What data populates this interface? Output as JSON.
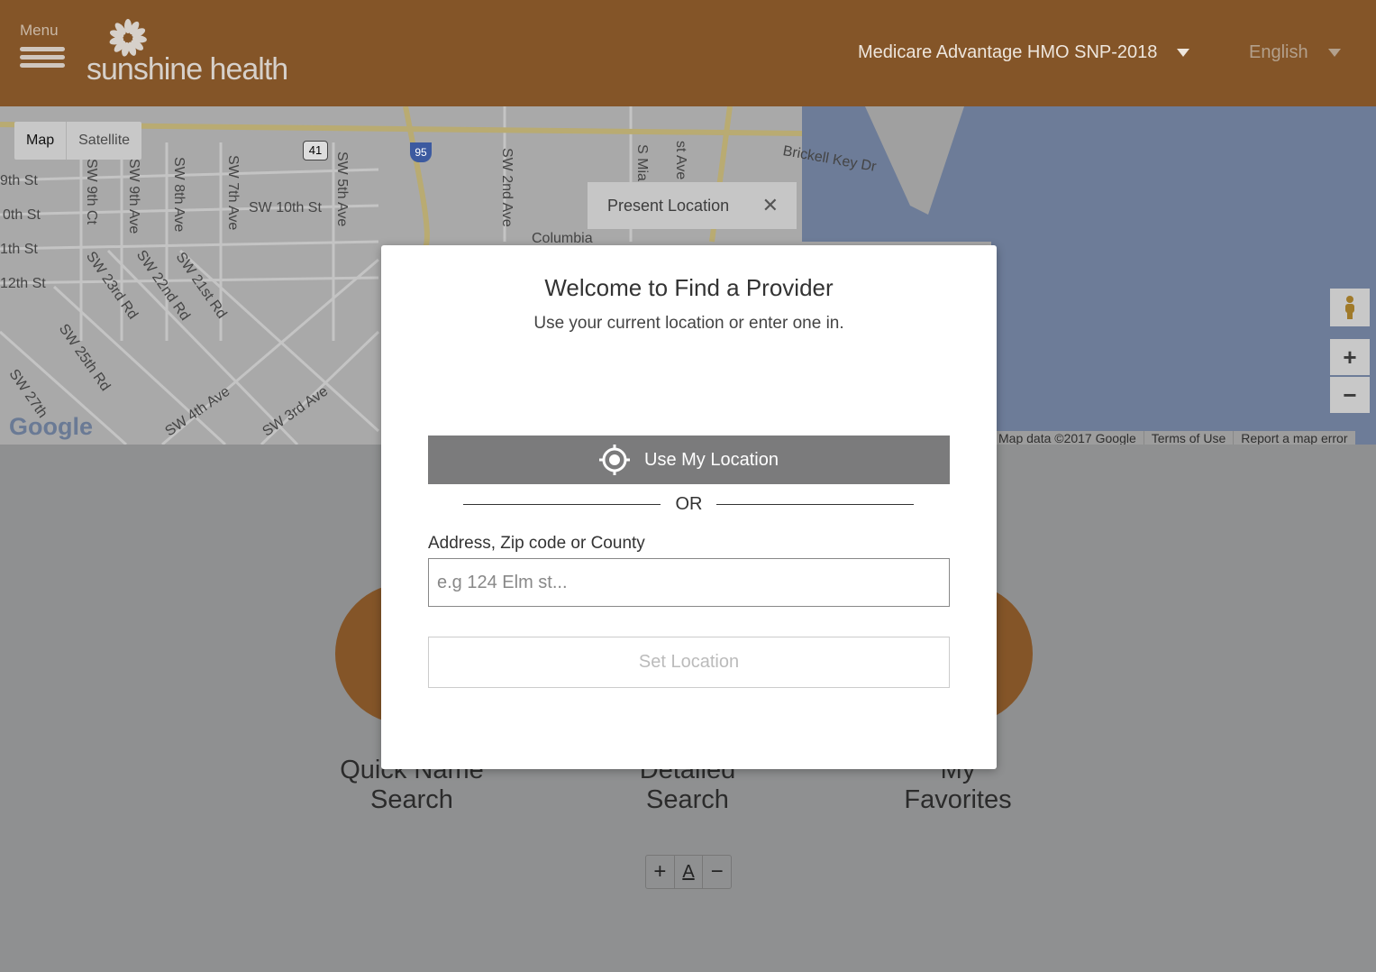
{
  "header": {
    "menu_label": "Menu",
    "logo_text": "sunshine health",
    "plan": "Medicare Advantage HMO SNP-2018",
    "language": "English",
    "brand_color": "#845528"
  },
  "map": {
    "type_map": "Map",
    "type_satellite": "Satellite",
    "present_location": "Present Location",
    "close": "✕",
    "zoom_in": "+",
    "zoom_out": "−",
    "footer": [
      "Map data ©2017 Google",
      "Terms of Use",
      "Report a map error"
    ],
    "google": "Google",
    "streets": [
      "9th St",
      "0th St",
      "1th St",
      "12th St",
      "SW 9th Ct",
      "SW 9th Ave",
      "SW 8th Ave",
      "SW 7th Ave",
      "SW 10th St",
      "SW 5th Ave",
      "SW 2nd Ave",
      "S Mia",
      "st Ave",
      "Brickell Key Dr",
      "SW 23rd Rd",
      "SW 22nd Rd",
      "SW 21st Rd",
      "SW 25th Rd",
      "SW 27th",
      "SW 4th Ave",
      "SW 4th Ave",
      "SW 3rd Ave",
      "SW 3r",
      "Columbia",
      "41",
      "95",
      "1"
    ]
  },
  "tiles": [
    {
      "label_1": "Quick Name",
      "label_2": "Search"
    },
    {
      "label_1": "Detailed",
      "label_2": "Search"
    },
    {
      "label_1": "My",
      "label_2": "Favorites"
    }
  ],
  "font_controls": {
    "increase": "+",
    "reset": "A",
    "decrease": "−"
  },
  "modal": {
    "title": "Welcome to Find a Provider",
    "subtitle": "Use your current location or enter one in.",
    "use_location": "Use My Location",
    "or": "OR",
    "field_label": "Address, Zip code or County",
    "placeholder": "e.g 124 Elm st...",
    "set_location": "Set Location"
  }
}
